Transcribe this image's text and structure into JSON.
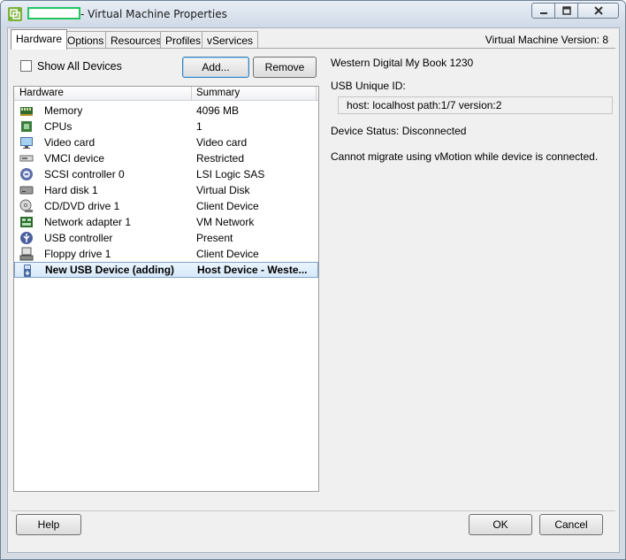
{
  "window": {
    "title": "- Virtual Machine Properties",
    "controls": [
      "minimize-icon",
      "maximize-icon",
      "close-icon"
    ]
  },
  "tabs": [
    {
      "label": "Hardware",
      "active": true
    },
    {
      "label": "Options",
      "active": false
    },
    {
      "label": "Resources",
      "active": false
    },
    {
      "label": "Profiles",
      "active": false
    },
    {
      "label": "vServices",
      "active": false
    }
  ],
  "version_label": "Virtual Machine Version: 8",
  "show_all_devices": {
    "label": "Show All Devices",
    "checked": false
  },
  "buttons": {
    "add": "Add...",
    "remove": "Remove",
    "help": "Help",
    "ok": "OK",
    "cancel": "Cancel"
  },
  "hardware_table": {
    "headers": [
      "Hardware",
      "Summary"
    ],
    "rows": [
      {
        "name": "Memory",
        "summary": "4096 MB",
        "icon": "memory-icon"
      },
      {
        "name": "CPUs",
        "summary": "1",
        "icon": "cpu-icon"
      },
      {
        "name": "Video card",
        "summary": "Video card",
        "icon": "monitor-icon"
      },
      {
        "name": "VMCI device",
        "summary": "Restricted",
        "icon": "device-icon"
      },
      {
        "name": "SCSI controller 0",
        "summary": "LSI Logic SAS",
        "icon": "scsi-icon"
      },
      {
        "name": "Hard disk 1",
        "summary": "Virtual Disk",
        "icon": "hard-disk-icon"
      },
      {
        "name": "CD/DVD drive 1",
        "summary": "Client Device",
        "icon": "cd-dvd-icon"
      },
      {
        "name": "Network adapter 1",
        "summary": "VM Network",
        "icon": "network-icon"
      },
      {
        "name": "USB controller",
        "summary": "Present",
        "icon": "usb-controller-icon"
      },
      {
        "name": "Floppy drive 1",
        "summary": "Client Device",
        "icon": "floppy-icon"
      },
      {
        "name": "New USB Device (adding)",
        "summary": "Host Device - Weste...",
        "icon": "usb-device-icon",
        "selected": true
      }
    ]
  },
  "device_panel": {
    "device_name": "Western Digital My Book 1230",
    "uid_label": "USB Unique ID:",
    "uid_value": "host: localhost path:1/7 version:2",
    "status": "Device Status: Disconnected",
    "note": "Cannot migrate using vMotion while device is connected."
  },
  "colors": {
    "redaction_border": "#22c55e",
    "selection": "#d6e9fa",
    "selection_border": "#7da2ce"
  }
}
